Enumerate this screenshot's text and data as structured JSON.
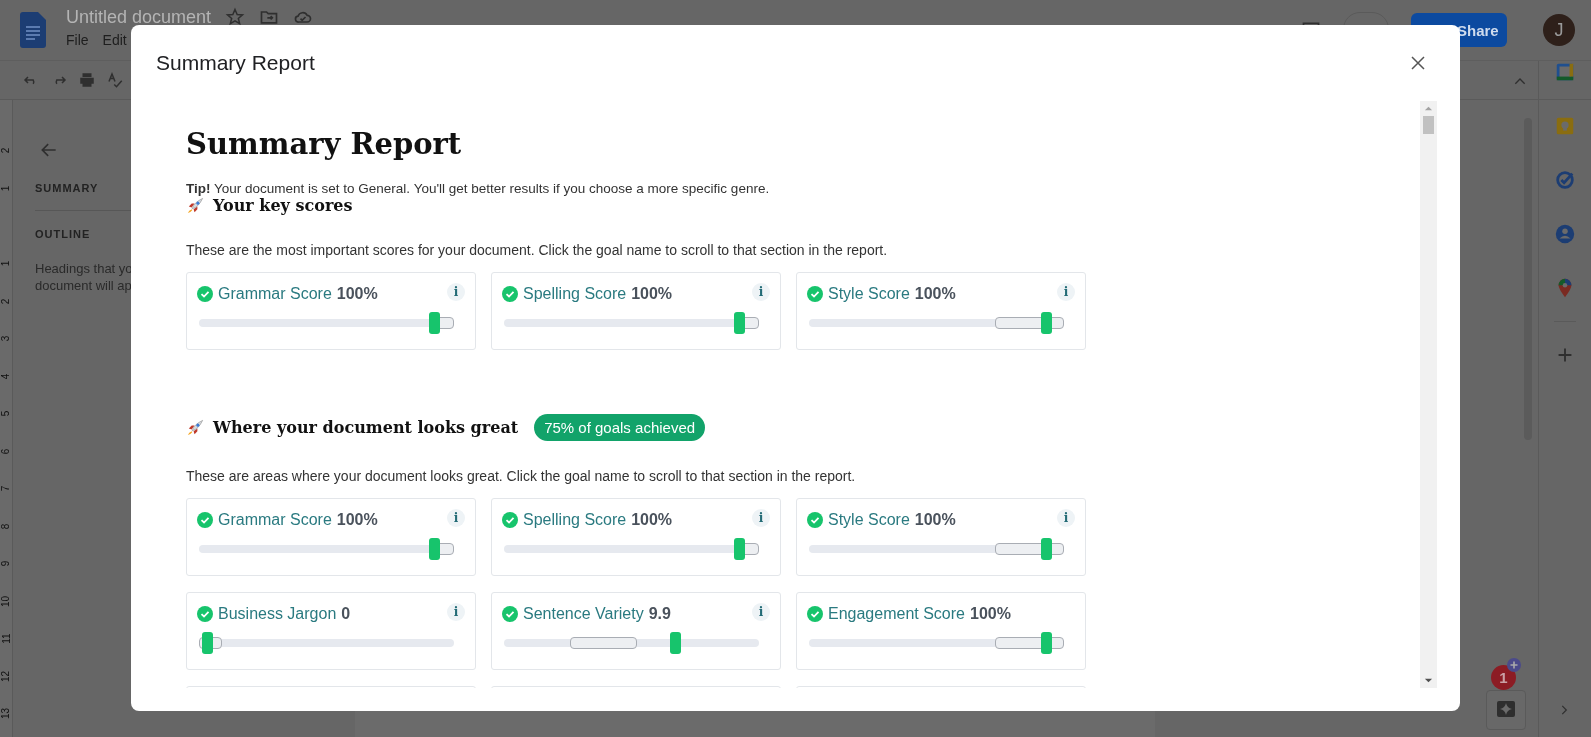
{
  "docs": {
    "title": "Untitled document",
    "menu": [
      "File",
      "Edit"
    ],
    "share": "Share",
    "avatar": "J",
    "sidebar": {
      "summary": "SUMMARY",
      "outline": "OUTLINE",
      "hint": [
        "Headings that yo",
        "document will ap"
      ]
    },
    "ruler_above": [
      "2",
      "1"
    ],
    "ruler_below": [
      "1",
      "2",
      "3",
      "4",
      "5",
      "6",
      "7",
      "8",
      "9",
      "10",
      "11",
      "12",
      "13"
    ],
    "notification": "1"
  },
  "dialog": {
    "title": "Summary Report",
    "heading": "Summary Report",
    "tip": "**Tip!** Your document is set to General. You'll get better results if you choose a more specific genre.",
    "sections": [
      {
        "title": "Your key scores",
        "description": "These are the most important scores for your document. Click the goal name to scroll to that section in the report.",
        "goals": [
          {
            "kind": "top",
            "label": "Grammar Score",
            "value": "100%",
            "info": "i",
            "level": 0.92
          },
          {
            "kind": "top",
            "label": "Spelling Score",
            "value": "100%",
            "info": "i",
            "level": 0.92
          },
          {
            "kind": "upper",
            "label": "Style Score",
            "value": "100%",
            "info": "i",
            "level": 0.93
          }
        ]
      },
      {
        "title": "Where your document looks great",
        "badge": "75% of goals achieved",
        "description": "These are areas where your document looks great. Click the goal name to scroll to that section in the report.",
        "goals": [
          {
            "kind": "top",
            "label": "Grammar Score",
            "value": "100%",
            "info": "i",
            "level": 0.92
          },
          {
            "kind": "top",
            "label": "Spelling Score",
            "value": "100%",
            "info": "i",
            "level": 0.92
          },
          {
            "kind": "upper",
            "label": "Style Score",
            "value": "100%",
            "info": "i",
            "level": 0.93
          },
          {
            "kind": "bottom",
            "label": "Business Jargon",
            "value": "0",
            "info": "i",
            "level": 0.03
          },
          {
            "kind": "middle",
            "label": "Sentence Variety",
            "value": "9.9",
            "info": "i",
            "level": 0.67
          },
          {
            "kind": "upper",
            "label": "Engagement Score",
            "value": "100%",
            "level": 0.93
          },
          {
            "kind": "cut"
          },
          {
            "kind": "cut"
          },
          {
            "kind": "cut"
          }
        ]
      }
    ]
  }
}
